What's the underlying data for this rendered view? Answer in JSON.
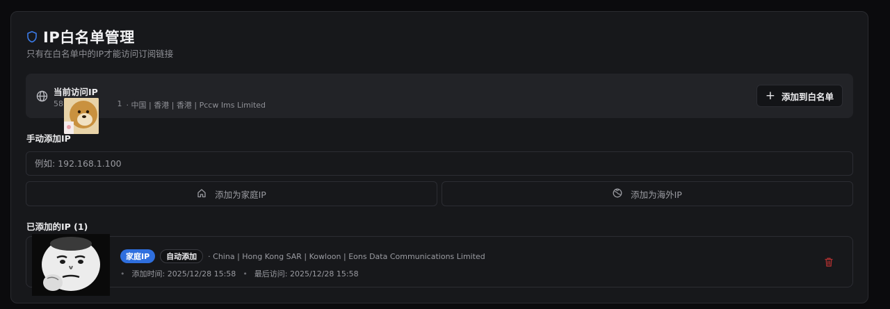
{
  "header": {
    "title": "IP白名单管理",
    "subtitle": "只有在白名单中的IP才能访问订阅链接"
  },
  "current_ip": {
    "label": "当前访问IP",
    "ip_prefix": "58.",
    "ip_suffix": "1",
    "location": "· 中国 | 香港 | 香港 | Pccw Ims Limited",
    "add_button": "添加到白名单"
  },
  "manual": {
    "label": "手动添加IP",
    "placeholder": "例如: 192.168.1.100",
    "add_home_button": "添加为家庭IP",
    "add_overseas_button": "添加为海外IP"
  },
  "added": {
    "label": "已添加的IP (1)",
    "items": [
      {
        "badge_type": "家庭IP",
        "badge_source": "自动添加",
        "location": "· China | Hong Kong SAR | Kowloon | Eons Data Communications Limited",
        "added_time": "添加时间: 2025/12/28 15:58",
        "last_visit": "最后访问: 2025/12/28 15:58"
      }
    ]
  },
  "colors": {
    "accent": "#2f6fde",
    "danger": "#b03030",
    "background": "#17181b"
  },
  "icons": [
    "shield-icon",
    "globe-icon",
    "plus-icon",
    "home-icon",
    "globe-grid-icon",
    "trash-icon"
  ]
}
